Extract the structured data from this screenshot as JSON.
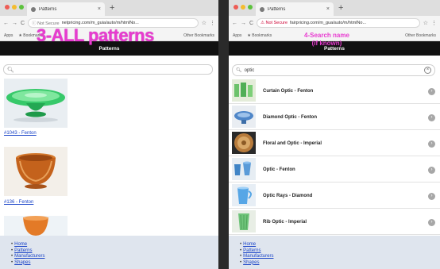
{
  "left_window": {
    "tab_title": "Patterns",
    "tab_close": "×",
    "new_tab": "+",
    "nav": {
      "back": "←",
      "forward": "→",
      "reload": "C"
    },
    "address": {
      "security": "ⓘ Not Secure",
      "url": "netpricing.com/m_guia/auto/m/htmlNo...",
      "star": "☆"
    },
    "bookmarks": {
      "apps": "Apps",
      "bookmarks": "★ Bookmarks",
      "other": "Other Bookmarks"
    },
    "site_header": "Patterns",
    "overlay_label": "3-ALL patterns",
    "search": {
      "placeholder": "",
      "icon": "search-icon"
    },
    "items": [
      {
        "caption": "#1043 - Fenton"
      },
      {
        "caption": "#136 - Fenton"
      },
      {
        "caption": ""
      }
    ],
    "footer_links": [
      "Home",
      "Patterns",
      "Manufacturers",
      "Shapes"
    ]
  },
  "right_window": {
    "tab_title": "Patterns",
    "tab_close": "×",
    "new_tab": "+",
    "nav": {
      "back": "←",
      "forward": "→",
      "reload": "C"
    },
    "address": {
      "security": "⚠ Not Secure",
      "url": "fairpricing.com/m_gua/auto/m/htmlNo...",
      "star": "☆"
    },
    "bookmarks": {
      "apps": "Apps",
      "bookmarks": "★ Bookmarks",
      "other": "Other Bookmarks"
    },
    "site_header": "Patterns",
    "overlay_label_line1": "4-Search name",
    "overlay_label_line2": "(if known)",
    "search": {
      "value": "optic",
      "clear": "×",
      "icon": "search-icon"
    },
    "results": [
      {
        "label": "Curtain Optic - Fenton"
      },
      {
        "label": "Diamond Optic - Fenton"
      },
      {
        "label": "Floral and Optic - Imperial"
      },
      {
        "label": "Optic - Fenton"
      },
      {
        "label": "Optic Rays - Diamond"
      },
      {
        "label": "Rib Optic - Imperial"
      }
    ],
    "footer_links": [
      "Home",
      "Patterns",
      "Manufacturers",
      "Shapes"
    ]
  },
  "colors": {
    "overlay": "#e83bd0",
    "site_header_bg": "#111111",
    "link": "#1a44c8",
    "footer_bg": "#dfe5ee",
    "traffic_red": "#ee5c55",
    "traffic_yellow": "#f4bc2f",
    "traffic_green": "#5cc23d"
  }
}
